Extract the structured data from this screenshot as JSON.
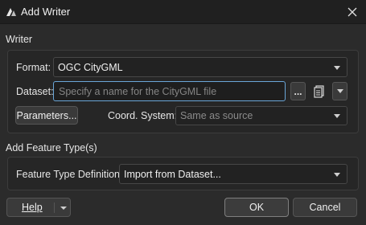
{
  "window": {
    "title": "Add Writer",
    "icons": {
      "app": "fme-app-icon",
      "close": "close-icon"
    }
  },
  "writer": {
    "section_label": "Writer",
    "format_label": "Format:",
    "format_value": "OGC CityGML",
    "dataset_label": "Dataset:",
    "dataset_value": "",
    "dataset_placeholder": "Specify a name for the CityGML file",
    "browse_label": "...",
    "parameters_label": "Parameters...",
    "coord_label": "Coord. System:",
    "coord_value": "Same as source"
  },
  "feature_types": {
    "section_label": "Add Feature Type(s)",
    "definition_label": "Feature Type Definition:",
    "definition_value": "Import from Dataset..."
  },
  "footer": {
    "help_label": "Help",
    "ok_label": "OK",
    "cancel_label": "Cancel"
  },
  "colors": {
    "background": "#2b2b2b",
    "focus_border": "#6aa6d8"
  }
}
